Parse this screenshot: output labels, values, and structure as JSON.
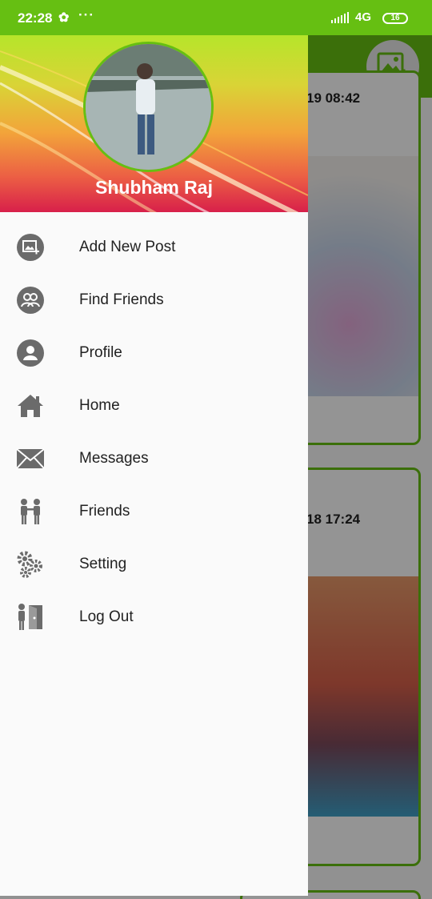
{
  "status_bar": {
    "time": "22:28",
    "more": "···",
    "network": "4G",
    "battery": "16"
  },
  "background_posts": [
    {
      "time": "19 08:42"
    },
    {
      "time": "18  17:24"
    }
  ],
  "drawer": {
    "user_name": "Shubham Raj",
    "menu": [
      {
        "label": "Add New Post",
        "icon": "add-photo-icon"
      },
      {
        "label": "Find Friends",
        "icon": "find-friends-icon"
      },
      {
        "label": "Profile",
        "icon": "profile-icon"
      },
      {
        "label": "Home",
        "icon": "home-icon"
      },
      {
        "label": "Messages",
        "icon": "mail-icon"
      },
      {
        "label": "Friends",
        "icon": "friends-icon"
      },
      {
        "label": "Setting",
        "icon": "gears-icon"
      },
      {
        "label": "Log Out",
        "icon": "logout-icon"
      }
    ]
  },
  "colors": {
    "accent": "#66bf12",
    "icon": "#6b6b6b"
  }
}
